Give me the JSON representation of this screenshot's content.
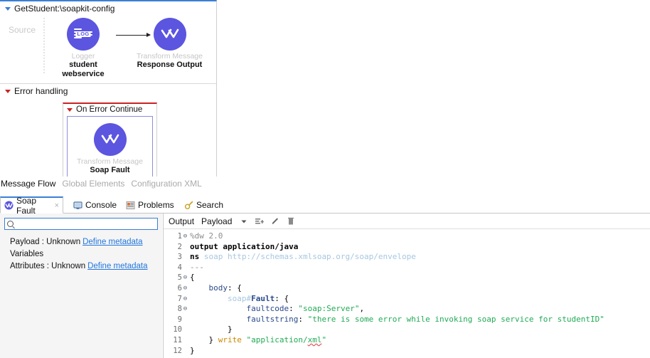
{
  "canvas": {
    "main_flow": {
      "title": "GetStudent:\\soapkit-config",
      "source_label": "Source",
      "nodes": [
        {
          "type": "Logger",
          "name": "student\nwebservice",
          "icon": "logger-icon"
        },
        {
          "type": "Transform Message",
          "name": "Response Output",
          "icon": "transform-message-icon"
        }
      ]
    },
    "error_flow": {
      "title": "Error handling",
      "scope_title": "On Error Continue",
      "node": {
        "type": "Transform Message",
        "name": "Soap Fault",
        "icon": "transform-message-icon"
      }
    }
  },
  "editor_mode_tabs": [
    {
      "label": "Message Flow",
      "active": true
    },
    {
      "label": "Global Elements",
      "active": false
    },
    {
      "label": "Configuration XML",
      "active": false
    }
  ],
  "view_tabs": [
    {
      "label": "Soap Fault",
      "icon": "transform-message-icon",
      "active": true,
      "closeable": true,
      "close_label": "×"
    },
    {
      "label": "Console",
      "icon": "console-icon",
      "active": false
    },
    {
      "label": "Problems",
      "icon": "problems-icon",
      "active": false
    },
    {
      "label": "Search",
      "icon": "search-icon",
      "active": false
    }
  ],
  "tree_panel": {
    "search": {
      "value": "",
      "placeholder": "",
      "icon": "magnifier-icon"
    },
    "rows": [
      {
        "label": "Payload : Unknown",
        "link": "Define metadata"
      },
      {
        "label": "Variables",
        "link": ""
      },
      {
        "label": "Attributes : Unknown",
        "link": "Define metadata"
      }
    ]
  },
  "code_panel": {
    "toolbar": {
      "output_label": "Output",
      "payload_label": "Payload",
      "icons": [
        "chevron-down-icon",
        "add-list-icon",
        "pencil-icon",
        "trash-icon"
      ]
    },
    "lines": [
      {
        "n": "1",
        "fold": true,
        "tokens": [
          {
            "t": "%dw ",
            "c": "k-dir"
          },
          {
            "t": "2.0",
            "c": "k-dir"
          }
        ]
      },
      {
        "n": "2",
        "fold": false,
        "tokens": [
          {
            "t": "output application/java",
            "c": "k-bold"
          }
        ]
      },
      {
        "n": "3",
        "fold": false,
        "tokens": [
          {
            "t": "ns ",
            "c": "k-bold"
          },
          {
            "t": "soap http://schemas.xmlsoap.org/soap/envelope",
            "c": "k-ns"
          }
        ]
      },
      {
        "n": "4",
        "fold": false,
        "tokens": [
          {
            "t": "---",
            "c": "k-dir"
          }
        ]
      },
      {
        "n": "5",
        "fold": true,
        "tokens": [
          {
            "t": "{",
            "c": "k-op"
          }
        ]
      },
      {
        "n": "6",
        "fold": true,
        "tokens": [
          {
            "t": "    ",
            "c": "k-op"
          },
          {
            "t": "body",
            "c": "k-key"
          },
          {
            "t": ": {",
            "c": "k-op"
          }
        ]
      },
      {
        "n": "7",
        "fold": true,
        "tokens": [
          {
            "t": "        ",
            "c": "k-op"
          },
          {
            "t": "soap#",
            "c": "k-soapfx"
          },
          {
            "t": "Fault",
            "c": "k-fault"
          },
          {
            "t": ": {",
            "c": "k-op"
          }
        ]
      },
      {
        "n": "8",
        "fold": true,
        "tokens": [
          {
            "t": "            ",
            "c": "k-op"
          },
          {
            "t": "faultcode",
            "c": "k-key"
          },
          {
            "t": ": ",
            "c": "k-op"
          },
          {
            "t": "\"soap:Server\"",
            "c": "k-str"
          },
          {
            "t": ",",
            "c": "k-op"
          }
        ]
      },
      {
        "n": "9",
        "fold": false,
        "tokens": [
          {
            "t": "            ",
            "c": "k-op"
          },
          {
            "t": "faultstring",
            "c": "k-key"
          },
          {
            "t": ": ",
            "c": "k-op"
          },
          {
            "t": "\"there is some error while invoking soap service for studentID\"",
            "c": "k-str"
          }
        ]
      },
      {
        "n": "10",
        "fold": false,
        "tokens": [
          {
            "t": "        }",
            "c": "k-op"
          }
        ]
      },
      {
        "n": "11",
        "fold": false,
        "tokens": [
          {
            "t": "    } ",
            "c": "k-op"
          },
          {
            "t": "write",
            "c": "k-write"
          },
          {
            "t": " \"application/",
            "c": "k-str"
          },
          {
            "t": "xml",
            "c": "k-str sq"
          },
          {
            "t": "\"",
            "c": "k-str"
          }
        ]
      },
      {
        "n": "12",
        "fold": false,
        "tokens": [
          {
            "t": "}",
            "c": "k-op"
          }
        ]
      }
    ]
  },
  "colors": {
    "node_purple": "#5b55e0",
    "accent_blue": "#3a7fd5",
    "error_red": "#cc2222",
    "link_blue": "#2277dd",
    "string_green": "#22aa55"
  }
}
